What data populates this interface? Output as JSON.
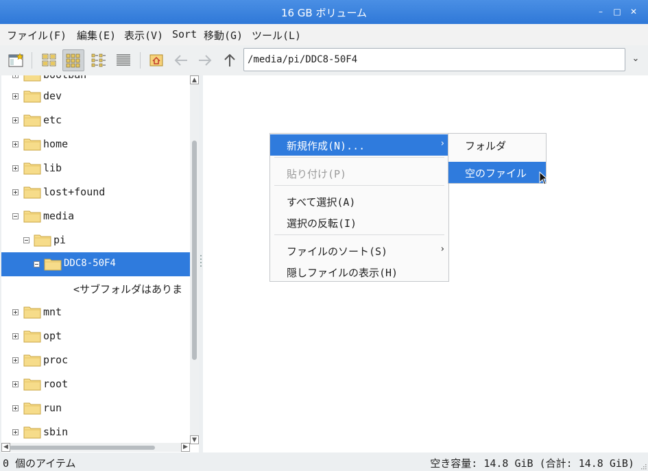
{
  "window": {
    "title": "16 GB ボリューム",
    "minimize_glyph": "–",
    "maximize_glyph": "□",
    "close_glyph": "✕"
  },
  "menubar": [
    {
      "label": "ファイル(F)"
    },
    {
      "label": "編集(E)"
    },
    {
      "label": "表示(V)"
    },
    {
      "label": "Sort"
    },
    {
      "label": "移動(G)"
    },
    {
      "label": "ツール(L)"
    }
  ],
  "toolbar": {
    "buttons": [
      "new-window-icon",
      "icon-view-icon",
      "thumbnail-view-icon",
      "compact-view-icon",
      "detailed-list-view-icon",
      "home-icon",
      "back-arrow-icon",
      "forward-arrow-icon",
      "up-arrow-icon"
    ],
    "active_view": "thumbnail-view-icon",
    "path": "/media/pi/DDC8-50F4"
  },
  "tree": {
    "partial_top": "bootban",
    "items": [
      {
        "label": "dev"
      },
      {
        "label": "etc"
      },
      {
        "label": "home"
      },
      {
        "label": "lib"
      },
      {
        "label": "lost+found"
      },
      {
        "label": "media"
      },
      {
        "label": "pi"
      },
      {
        "label": "DDC8-50F4"
      },
      {
        "label": "<サブフォルダはありま"
      },
      {
        "label": "mnt"
      },
      {
        "label": "opt"
      },
      {
        "label": "proc"
      },
      {
        "label": "root"
      },
      {
        "label": "run"
      },
      {
        "label": "sbin"
      }
    ],
    "selected": "DDC8-50F4"
  },
  "context_menu": {
    "items": [
      {
        "label": "新規作成(N)...",
        "submenu": true,
        "highlighted": true
      },
      {
        "label": "貼り付け(P)",
        "disabled": true
      },
      {
        "label": "すべて選択(A)"
      },
      {
        "label": "選択の反転(I)"
      },
      {
        "label": "ファイルのソート(S)",
        "submenu": true
      },
      {
        "label": "隠しファイルの表示(H)"
      }
    ],
    "submenu_arrow": "›"
  },
  "submenu": {
    "items": [
      {
        "label": "フォルダ"
      },
      {
        "label": "空のファイル",
        "highlighted": true
      }
    ]
  },
  "statusbar": {
    "left": "0 個のアイテム",
    "right": "空き容量: 14.8 GiB (合計: 14.8 GiB)"
  },
  "colors": {
    "titlebar": "#3a84de",
    "selection": "#2f7bdd",
    "folder_fill": "#f6dc8a",
    "folder_stroke": "#c9a646"
  }
}
